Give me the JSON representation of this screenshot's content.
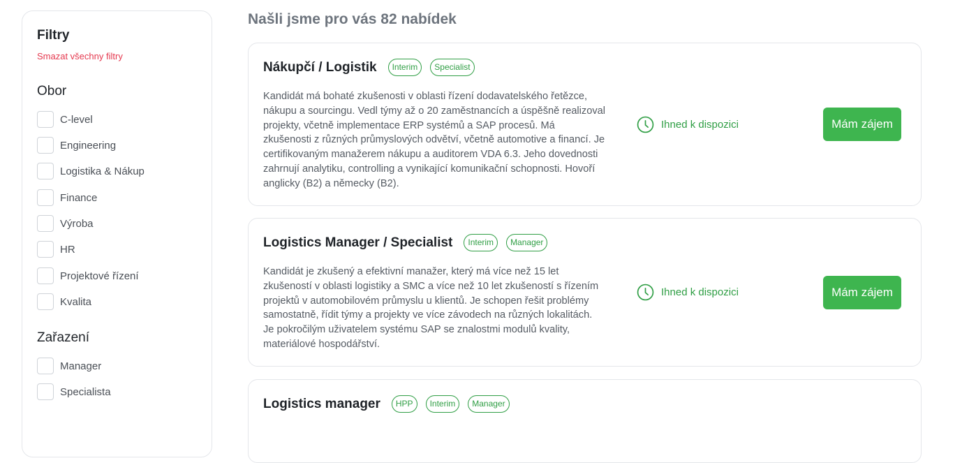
{
  "sidebar": {
    "title": "Filtry",
    "clear_label": "Smazat všechny filtry",
    "obor": {
      "title": "Obor",
      "items": [
        "C-level",
        "Engineering",
        "Logistika & Nákup",
        "Finance",
        "Výroba",
        "HR",
        "Projektové řízení",
        "Kvalita"
      ]
    },
    "zarazeni": {
      "title": "Zařazení",
      "items": [
        "Manager",
        "Specialista"
      ]
    }
  },
  "results": {
    "heading": "Našli jsme pro vás 82 nabídek"
  },
  "cards": [
    {
      "title": "Nákupčí / Logistik",
      "tags": [
        "Interim",
        "Specialist"
      ],
      "description": "Kandidát má bohaté zkušenosti v oblasti řízení dodavatelského řetězce, nákupu a sourcingu. Vedl týmy až o 20 zaměstnancích a úspěšně realizoval projekty, včetně implementace ERP systémů a SAP procesů. Má zkušenosti z různých průmyslových odvětví, včetně automotive a financí. Je certifikovaným manažerem nákupu a auditorem VDA 6.3. Jeho dovednosti zahrnují analytiku, controlling a vynikající komunikační schopnosti. Hovoří anglicky (B2) a německy (B2).",
      "availability": "Ihned k dispozici",
      "button": "Mám zájem"
    },
    {
      "title": "Logistics Manager / Specialist",
      "tags": [
        "Interim",
        "Manager"
      ],
      "description": "Kandidát je zkušený a efektivní manažer, který má více než 15 let zkušeností v oblasti logistiky a SMC a více než 10 let zkušeností s řízením projektů v automobilovém průmyslu u klientů. Je schopen řešit problémy samostatně, řídit týmy a projekty ve více závodech na různých lokalitách. Je pokročilým uživatelem systému SAP se znalostmi modulů kvality, materiálové hospodářství.",
      "availability": "Ihned k dispozici",
      "button": "Mám zájem"
    },
    {
      "title": "Logistics manager",
      "tags": [
        "HPP",
        "Interim",
        "Manager"
      ]
    }
  ],
  "colors": {
    "accent": "#3eb54f",
    "tag": "#2f9e44",
    "clear_link": "#e5394f"
  }
}
